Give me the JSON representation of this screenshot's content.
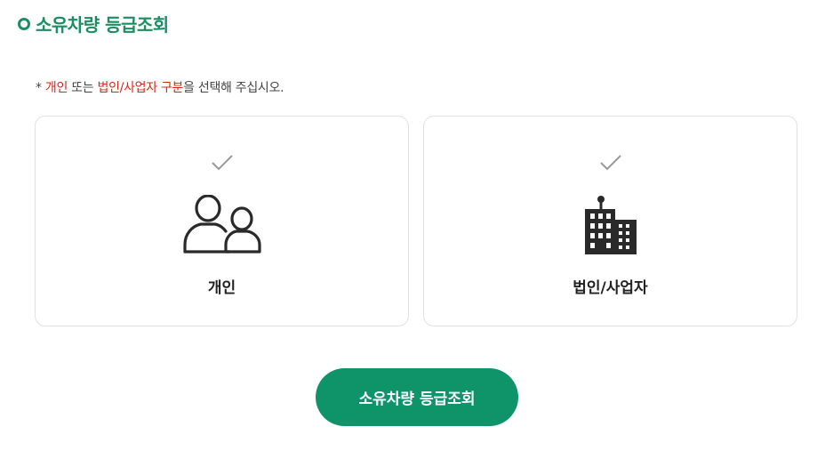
{
  "page": {
    "title": "소유차량 등급조회"
  },
  "notice": {
    "prefix": "* ",
    "term1": "개인",
    "mid1": " 또는 ",
    "term2": "법인/사업자 구분",
    "suffix": "을 선택해 주십시오."
  },
  "options": [
    {
      "label": "개인",
      "icon": "people-icon",
      "check_icon": "check-icon"
    },
    {
      "label": "법인/사업자",
      "icon": "building-icon",
      "check_icon": "check-icon"
    }
  ],
  "submit": {
    "label": "소유차량 등급조회"
  },
  "colors": {
    "accent": "#0e9468",
    "title": "#1a8f63",
    "highlight": "#d3291b",
    "check": "#999999"
  }
}
